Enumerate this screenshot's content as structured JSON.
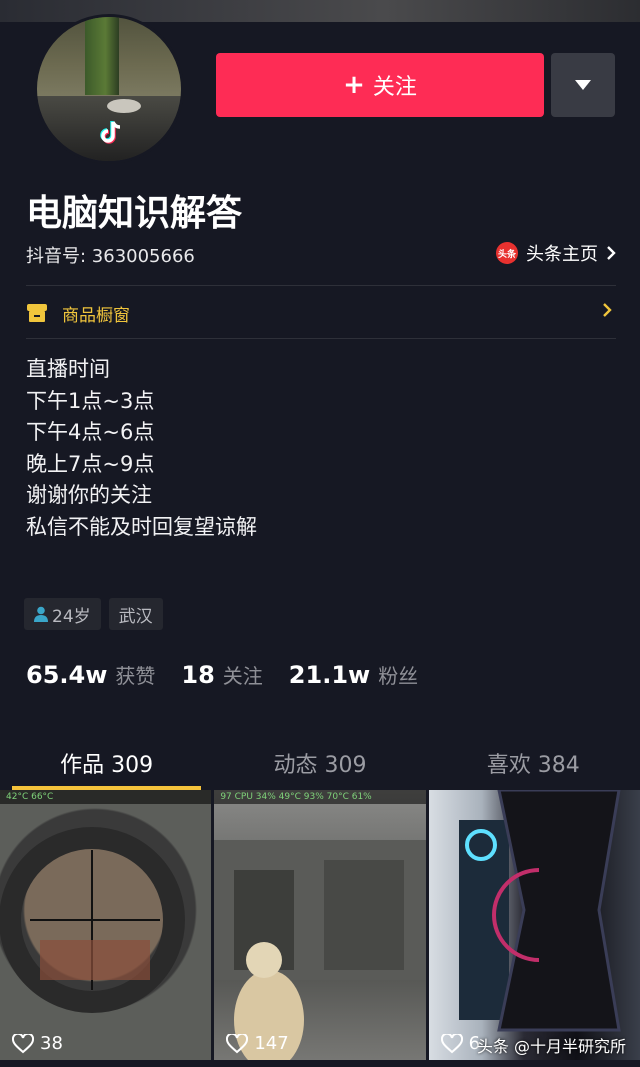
{
  "profile": {
    "nickname": "电脑知识解答",
    "douyin_id": "抖音号: 363005666",
    "toutiao_badge": "头条",
    "toutiao_link": "头条主页"
  },
  "actions": {
    "follow_plus": "+",
    "follow_label": "关注"
  },
  "shop": {
    "label": "商品橱窗"
  },
  "bio": {
    "lines": [
      "直播时间",
      "下午1点~3点",
      "下午4点~6点",
      "晚上7点~9点",
      "谢谢你的关注",
      "私信不能及时回复望谅解"
    ]
  },
  "tags": {
    "age": "24岁",
    "city": "武汉"
  },
  "stats": [
    {
      "num": "65.4w",
      "label": "获赞"
    },
    {
      "num": "18",
      "label": "关注"
    },
    {
      "num": "21.1w",
      "label": "粉丝"
    }
  ],
  "tabs": [
    {
      "label": "作品 309",
      "active": true
    },
    {
      "label": "动态 309",
      "active": false
    },
    {
      "label": "喜欢 384",
      "active": false
    }
  ],
  "videos": [
    {
      "likes": "38",
      "hud": "42°C  66°C"
    },
    {
      "likes": "147",
      "hud": "97  CPU 34%  49°C  93%  70°C  61%"
    },
    {
      "likes": "6"
    }
  ],
  "watermark": "头条 @十月半研究所",
  "colors": {
    "background": "#161823",
    "follow_button": "#fe2c55",
    "tab_indicator": "#f5c23b",
    "shop_text": "#f0c53c"
  }
}
